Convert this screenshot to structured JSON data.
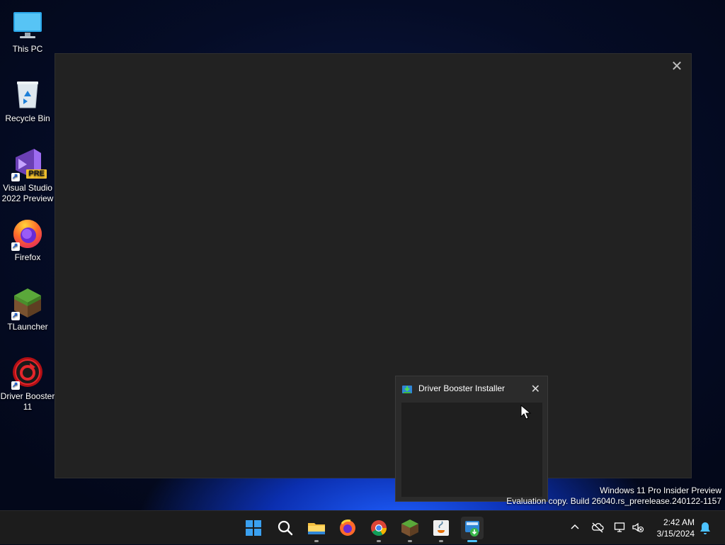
{
  "desktop": {
    "icons": [
      {
        "label": "This PC",
        "icon": "monitor-icon"
      },
      {
        "label": "Recycle Bin",
        "icon": "recycle-bin-icon"
      },
      {
        "label": "Visual Studio 2022 Preview",
        "icon": "visual-studio-icon",
        "badge": "PRE"
      },
      {
        "label": "Firefox",
        "icon": "firefox-icon"
      },
      {
        "label": "TLauncher",
        "icon": "tlauncher-icon"
      },
      {
        "label": "Driver Booster 11",
        "icon": "driver-booster-icon"
      }
    ]
  },
  "main_window": {
    "close_glyph": "✕"
  },
  "installer_dialog": {
    "title": "Driver Booster Installer",
    "close_glyph": "✕"
  },
  "watermark": {
    "line1": "Windows 11 Pro Insider Preview",
    "line2": "Evaluation copy. Build 26040.rs_prerelease.240122-1157"
  },
  "taskbar": {
    "apps": [
      "start-icon",
      "search-icon",
      "file-explorer-icon",
      "firefox-icon",
      "chrome-icon",
      "tlauncher-icon",
      "java-icon",
      "driver-booster-setup-icon"
    ],
    "clock": {
      "time": "2:42 AM",
      "date": "3/15/2024"
    }
  },
  "colors": {
    "accent": "#4cc2ff",
    "window_bg": "#222222",
    "taskbar_bg": "#1c1c1c"
  }
}
